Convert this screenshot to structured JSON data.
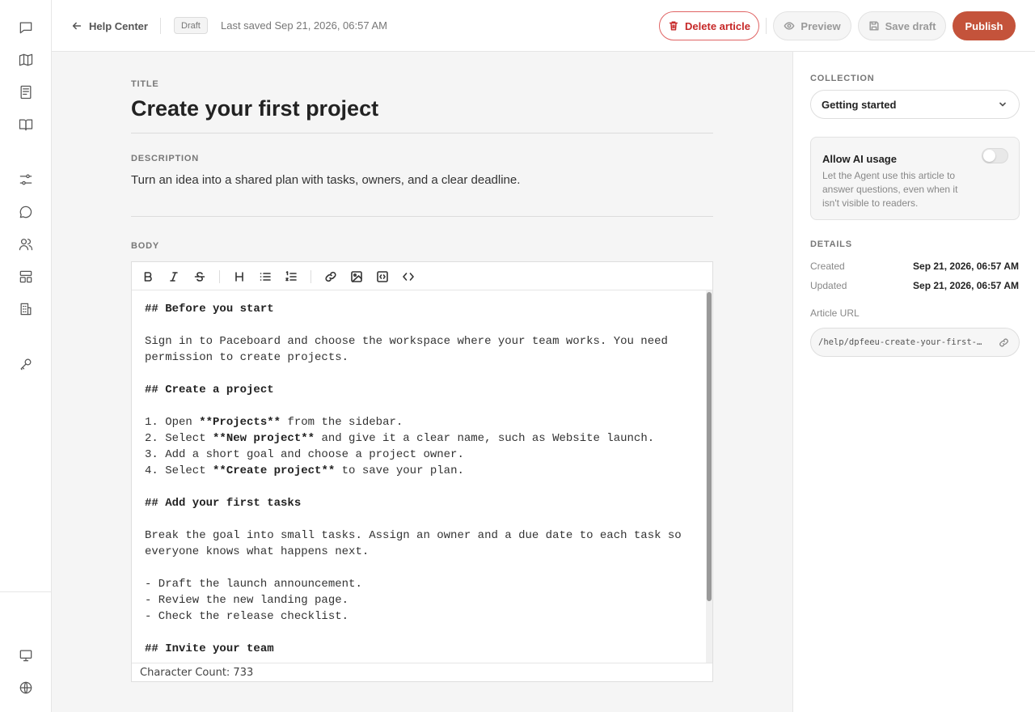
{
  "topbar": {
    "back_label": "Help Center",
    "status_badge": "Draft",
    "last_saved": "Last saved Sep 21, 2026, 06:57 AM",
    "delete_label": "Delete article",
    "preview_label": "Preview",
    "save_draft_label": "Save draft",
    "publish_label": "Publish"
  },
  "rail": {
    "icons": [
      "chat-bubble-icon",
      "map-icon",
      "newspaper-icon",
      "book-open-icon",
      "sliders-icon",
      "message-circle-icon",
      "users-icon",
      "layout-icon",
      "building-icon",
      "key-icon",
      "monitor-icon",
      "globe-icon"
    ]
  },
  "editor": {
    "title_label": "TITLE",
    "title": "Create your first project",
    "description_label": "DESCRIPTION",
    "description": "Turn an idea into a shared plan with tasks, owners, and a clear deadline.",
    "body_label": "BODY",
    "toolbar_tools": [
      "bold",
      "italic",
      "strikethrough",
      "heading",
      "bullet-list",
      "numbered-list",
      "link",
      "image",
      "embed",
      "code"
    ],
    "body_lines": [
      [
        {
          "t": "## Before you start",
          "b": true
        }
      ],
      [],
      [
        {
          "t": "Sign in to Paceboard and choose the workspace where your team works. You need"
        }
      ],
      [
        {
          "t": "permission to create projects."
        }
      ],
      [],
      [
        {
          "t": "## Create a project",
          "b": true
        }
      ],
      [],
      [
        {
          "t": "1. Open "
        },
        {
          "t": "**Projects**",
          "b": true
        },
        {
          "t": " from the sidebar."
        }
      ],
      [
        {
          "t": "2. Select "
        },
        {
          "t": "**New project**",
          "b": true
        },
        {
          "t": " and give it a clear name, such as Website launch."
        }
      ],
      [
        {
          "t": "3. Add a short goal and choose a project owner."
        }
      ],
      [
        {
          "t": "4. Select "
        },
        {
          "t": "**Create project**",
          "b": true
        },
        {
          "t": " to save your plan."
        }
      ],
      [],
      [
        {
          "t": "## Add your first tasks",
          "b": true
        }
      ],
      [],
      [
        {
          "t": "Break the goal into small tasks. Assign an owner and a due date to each task so"
        }
      ],
      [
        {
          "t": "everyone knows what happens next."
        }
      ],
      [],
      [
        {
          "t": "- Draft the launch announcement."
        }
      ],
      [
        {
          "t": "- Review the new landing page."
        }
      ],
      [
        {
          "t": "- Check the release checklist."
        }
      ],
      [],
      [
        {
          "t": "## Invite your team",
          "b": true
        }
      ]
    ],
    "character_count": "Character Count: 733"
  },
  "sidebar": {
    "collection_label": "COLLECTION",
    "collection_value": "Getting started",
    "ai_title": "Allow AI usage",
    "ai_description": "Let the Agent use this article to answer questions, even when it isn't visible to readers.",
    "ai_enabled": false,
    "details_label": "DETAILS",
    "created_label": "Created",
    "created_value": "Sep 21, 2026, 06:57 AM",
    "updated_label": "Updated",
    "updated_value": "Sep 21, 2026, 06:57 AM",
    "url_label": "Article URL",
    "url_value": "/help/dpfeeu-create-your-first-project"
  },
  "colors": {
    "publish": "#c4533b",
    "delete": "#c62828",
    "canvas": "#f5f5f5"
  }
}
